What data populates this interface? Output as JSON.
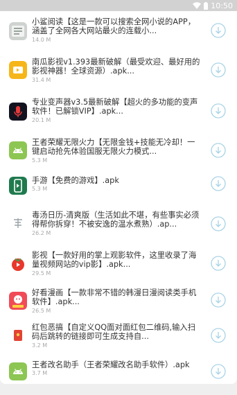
{
  "status_bar": {
    "time": "10:50"
  },
  "download_list": [
    {
      "name": "小鲨阅读【这是一款可以搜索全网小说的APP，涵盖了全网各大网站最火的连载小...",
      "size": "14.0 M",
      "icon": "xiaosha-reader-icon"
    },
    {
      "name": "南瓜影视v1.393最新破解（最受欢迎、最好用的影视神器！全球资源）.apk...",
      "size": "31.4 M",
      "icon": "nangua-video-icon"
    },
    {
      "name": "专业变声器v3.5最新破解【超火的多功能的变声软件！已解锁VIP】.apk...",
      "size": "20.1 M",
      "icon": "voice-changer-icon"
    },
    {
      "name": "王者荣耀无限火力【无限金钱+技能无冷却！一键启动抢先体验国服无限火力模式...",
      "size": "5.3 M",
      "icon": "android-apk-icon"
    },
    {
      "name": "手游【免费的游戏】.apk",
      "size": "5.3 M",
      "icon": "mobile-game-icon"
    },
    {
      "name": "毒汤日历-清爽版（生活如此不堪，有些事实必须得帮你拆穿！不被安逸的温水煮熟）.ap...",
      "size": "26.2 M",
      "icon": "dutang-calendar-icon"
    },
    {
      "name": "影视【一款好用的掌上观影软件，这里收录了海量视频网站的vip影】.apk...",
      "size": "29.5 M",
      "icon": "tomato-video-icon"
    },
    {
      "name": "好看漫画【一款非常不错的韩漫日漫阅读类手机软件】.apk...",
      "size": "26.5 M",
      "icon": "manga-reader-icon"
    },
    {
      "name": "红包恶搞【自定义QQ面对面红包二维码,输入扫码后跳转的链接即可生成支持自...",
      "size": "3.2 M",
      "icon": "red-packet-icon"
    },
    {
      "name": "王者改名助手（王者荣耀改名助手软件）.apk",
      "size": "3.7 M",
      "icon": "android-apk-icon"
    }
  ],
  "colors": {
    "download_button": "#a7d2e6",
    "android_green": "#8dc653",
    "nangua_yellow": "#f6b619",
    "mobile_game_green": "#1f7a4e",
    "red_packet": "#e34333"
  }
}
